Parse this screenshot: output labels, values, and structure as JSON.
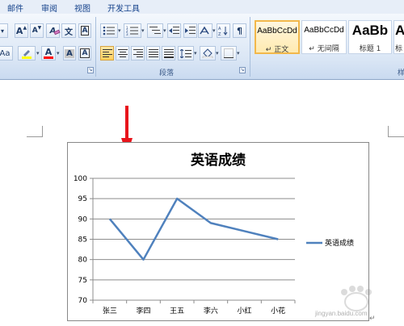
{
  "ribbon_tabs": [
    "邮件",
    "审阅",
    "视图",
    "开发工具"
  ],
  "font_group": {
    "grow_font": "A",
    "shrink_font": "A",
    "clear_format": "A",
    "phonetic": "文",
    "font_color": "A",
    "char_shading": "A",
    "char_border": "A",
    "font_size_partial": "Aa"
  },
  "paragraph_group": {
    "label": "段落"
  },
  "styles": [
    {
      "sample": "AaBbCcDd",
      "name": "↵ 正文",
      "active": true
    },
    {
      "sample": "AaBbCcDd",
      "name": "↵ 无间隔",
      "active": false
    },
    {
      "sample": "AaBb",
      "name": "标题 1",
      "active": false
    },
    {
      "sample": "AaB",
      "name": "标",
      "active": false
    }
  ],
  "styles_group_label_partial": "样",
  "chart_data": {
    "type": "line",
    "title": "英语成绩",
    "categories": [
      "张三",
      "李四",
      "王五",
      "李六",
      "小红",
      "小花"
    ],
    "series": [
      {
        "name": "英语成绩",
        "values": [
          90,
          80,
          95,
          89,
          87,
          85
        ],
        "color": "#4f81bd"
      }
    ],
    "ylim": [
      70,
      100
    ],
    "yticks": [
      100,
      95,
      90,
      85,
      80,
      75,
      70
    ],
    "grid": true,
    "legend": "right"
  },
  "colors": {
    "series": "#4f81bd",
    "arrow": "#e8141b",
    "ribbon_text": "#15428b"
  },
  "paragraph_mark": "↵",
  "watermark_text": "jingyan.baidu.com"
}
